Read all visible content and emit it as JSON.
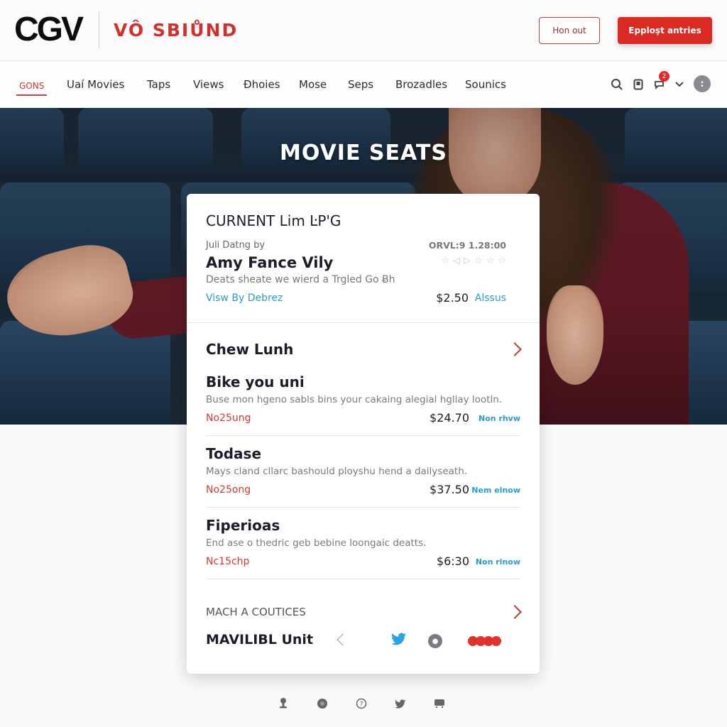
{
  "header": {
    "logo": "CGV",
    "brand": "VÔ SBIŮND",
    "sign_out_label": "Hon out",
    "primary_button_label": "Epploşt antries"
  },
  "nav": {
    "items": [
      {
        "label": "GONS",
        "active": true
      },
      {
        "label": "Uaí Movies",
        "active": false
      },
      {
        "label": "Taps",
        "active": false
      },
      {
        "label": "Views",
        "active": false
      },
      {
        "label": "Ðhoies",
        "active": false
      },
      {
        "label": "Mose",
        "active": false
      },
      {
        "label": "Seps",
        "active": false
      },
      {
        "label": "Brozadles",
        "active": false
      },
      {
        "label": "Sounics",
        "active": false
      }
    ],
    "icons": [
      "search-icon",
      "bookmark-icon",
      "chat-icon",
      "chevron-down-icon",
      "avatar"
    ],
    "notification_count": "2",
    "avatar_glyph": ":"
  },
  "hero": {
    "title": "MOVIE SEATS"
  },
  "card": {
    "current_title": "CURNENT Lim ĿP'G",
    "meta_label": "Juli Datng by",
    "meta_time": "ORVL:9 1.28:00",
    "movie_name": "Amy Fance Vily",
    "movie_desc": "Deats sheate we wierd a Trgled Go Ƀh",
    "view_link": "Visw By Debrez",
    "price": "$2.50",
    "price_link": "Alssus",
    "rating_glyphs": [
      "☆",
      "◁",
      "▷",
      "☆",
      "☆",
      "☆"
    ],
    "section_title": "Chew Lunh",
    "items": [
      {
        "title": "Bike you uni",
        "desc": "Buse mon hgeno sabls bins your cakaing alegial hgllay lootln.",
        "code": "No25ung",
        "price": "$24.70",
        "link": "Non rhvw"
      },
      {
        "title": "Todase",
        "desc": "Mays cland cllarc bashould ployshu hend a dailyseath.",
        "code": "No25ong",
        "price": "$37.50",
        "link": "Nem elnow"
      },
      {
        "title": "Fiperioas",
        "desc": "End ase o thedric geb bebine loongaic deatts.",
        "code": "Nc15chp",
        "price": "$6:30",
        "link": "Non rinow"
      }
    ],
    "match_heading": "MACH A COUTICES",
    "unit_label": "MAVILIBL Unit",
    "share_icons": [
      "back-icon",
      "twitter-icon",
      "account-icon",
      "dots-icon"
    ]
  },
  "footer": {
    "icons": [
      "pin-icon",
      "globe-icon",
      "help-icon",
      "twitter-icon",
      "chat-icon"
    ]
  },
  "colors": {
    "accent_red": "#db2a24",
    "link_blue": "#2a9cc8",
    "text_dark": "#1b1d28"
  }
}
